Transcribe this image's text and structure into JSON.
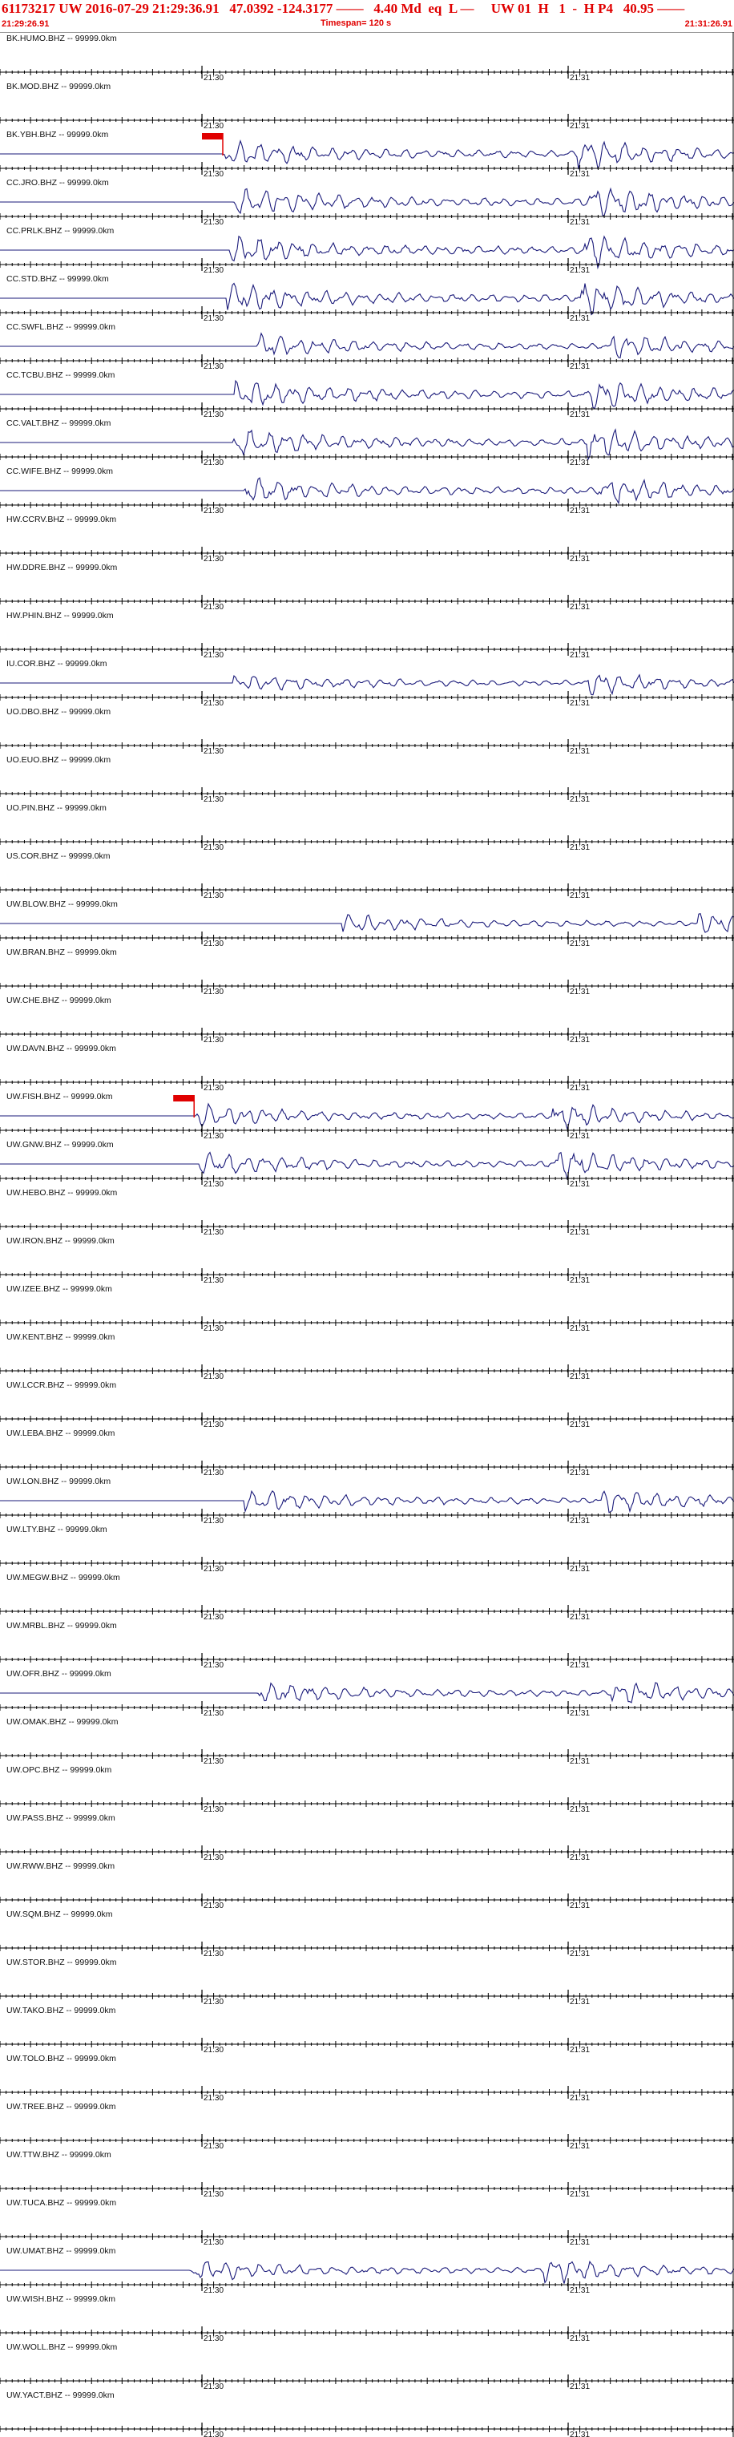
{
  "header": {
    "main": "61173217 UW 2016-07-29 21:29:36.91   47.0392 -124.3177 ——   4.40 Md  eq  L —     UW 01  H   1  -  H P4   40.95 ——",
    "left_time": "21:29:26.91",
    "right_time": "21:31:26.91",
    "timespan": "Timespan= 120 s"
  },
  "colors": {
    "header_text": "#e00000",
    "trace": "#1a1a7a",
    "pick": "#e00000",
    "axis": "#000000"
  },
  "chart_data": {
    "type": "line",
    "title": "61173217 UW 2016-07-29 21:29:36.91",
    "x_range_seconds": [
      0,
      120
    ],
    "x_tick_labels": [
      "21:30",
      "21:31"
    ],
    "x_tick_label_seconds": [
      33.09,
      93.09
    ],
    "traces": [
      {
        "label": "BK.HUMO.BHZ -- 99999.0km",
        "signal": false,
        "pick": null
      },
      {
        "label": "BK.MOD.BHZ -- 99999.0km",
        "signal": false,
        "pick": null
      },
      {
        "label": "BK.YBH.BHZ -- 99999.0km",
        "signal": true,
        "onset": 36.5,
        "amp": 0.9,
        "pick": 36.5
      },
      {
        "label": "CC.JRO.BHZ -- 99999.0km",
        "signal": true,
        "onset": 38.0,
        "amp": 1.0,
        "pick": null
      },
      {
        "label": "CC.PRLK.BHZ -- 99999.0km",
        "signal": true,
        "onset": 37.5,
        "amp": 1.0,
        "pick": null
      },
      {
        "label": "CC.STD.BHZ -- 99999.0km",
        "signal": true,
        "onset": 37.0,
        "amp": 1.0,
        "pick": null
      },
      {
        "label": "CC.SWFL.BHZ -- 99999.0km",
        "signal": true,
        "onset": 42.0,
        "amp": 0.8,
        "pick": null
      },
      {
        "label": "CC.TCBU.BHZ -- 99999.0km",
        "signal": true,
        "onset": 38.5,
        "amp": 1.0,
        "pick": null
      },
      {
        "label": "CC.VALT.BHZ -- 99999.0km",
        "signal": true,
        "onset": 38.0,
        "amp": 1.0,
        "pick": null
      },
      {
        "label": "CC.WIFE.BHZ -- 99999.0km",
        "signal": true,
        "onset": 40.0,
        "amp": 0.9,
        "pick": null
      },
      {
        "label": "HW.CCRV.BHZ -- 99999.0km",
        "signal": false,
        "pick": null
      },
      {
        "label": "HW.DDRE.BHZ -- 99999.0km",
        "signal": false,
        "pick": null
      },
      {
        "label": "HW.PHIN.BHZ -- 99999.0km",
        "signal": false,
        "pick": null
      },
      {
        "label": "IU.COR.BHZ -- 99999.0km",
        "signal": true,
        "onset": 38.0,
        "amp": 0.7,
        "pick": null
      },
      {
        "label": "UO.DBO.BHZ -- 99999.0km",
        "signal": false,
        "pick": null
      },
      {
        "label": "UO.EUO.BHZ -- 99999.0km",
        "signal": false,
        "pick": null
      },
      {
        "label": "UO.PIN.BHZ -- 99999.0km",
        "signal": false,
        "pick": null
      },
      {
        "label": "US.COR.BHZ -- 99999.0km",
        "signal": false,
        "pick": null
      },
      {
        "label": "UW.BLOW.BHZ -- 99999.0km",
        "signal": true,
        "onset": 56.0,
        "amp": 0.7,
        "pick": null
      },
      {
        "label": "UW.BRAN.BHZ -- 99999.0km",
        "signal": false,
        "pick": null
      },
      {
        "label": "UW.CHE.BHZ -- 99999.0km",
        "signal": false,
        "pick": null
      },
      {
        "label": "UW.DAVN.BHZ -- 99999.0km",
        "signal": false,
        "pick": null
      },
      {
        "label": "UW.FISH.BHZ -- 99999.0km",
        "signal": true,
        "onset": 32.0,
        "amp": 0.8,
        "pick": 31.8
      },
      {
        "label": "UW.GNW.BHZ -- 99999.0km",
        "signal": true,
        "onset": 32.5,
        "amp": 0.9,
        "pick": null
      },
      {
        "label": "UW.HEBO.BHZ -- 99999.0km",
        "signal": false,
        "pick": null
      },
      {
        "label": "UW.IRON.BHZ -- 99999.0km",
        "signal": false,
        "pick": null
      },
      {
        "label": "UW.IZEE.BHZ -- 99999.0km",
        "signal": false,
        "pick": null
      },
      {
        "label": "UW.KENT.BHZ -- 99999.0km",
        "signal": false,
        "pick": null
      },
      {
        "label": "UW.LCCR.BHZ -- 99999.0km",
        "signal": false,
        "pick": null
      },
      {
        "label": "UW.LEBA.BHZ -- 99999.0km",
        "signal": false,
        "pick": null
      },
      {
        "label": "UW.LON.BHZ -- 99999.0km",
        "signal": true,
        "onset": 40.0,
        "amp": 0.8,
        "pick": null
      },
      {
        "label": "UW.LTY.BHZ -- 99999.0km",
        "signal": false,
        "pick": null
      },
      {
        "label": "UW.MEGW.BHZ -- 99999.0km",
        "signal": false,
        "pick": null
      },
      {
        "label": "UW.MRBL.BHZ -- 99999.0km",
        "signal": false,
        "pick": null
      },
      {
        "label": "UW.OFR.BHZ -- 99999.0km",
        "signal": true,
        "onset": 42.0,
        "amp": 0.8,
        "pick": null
      },
      {
        "label": "UW.OMAK.BHZ -- 99999.0km",
        "signal": false,
        "pick": null
      },
      {
        "label": "UW.OPC.BHZ -- 99999.0km",
        "signal": false,
        "pick": null
      },
      {
        "label": "UW.PASS.BHZ -- 99999.0km",
        "signal": false,
        "pick": null
      },
      {
        "label": "UW.RWW.BHZ -- 99999.0km",
        "signal": false,
        "pick": null
      },
      {
        "label": "UW.SQM.BHZ -- 99999.0km",
        "signal": false,
        "pick": null
      },
      {
        "label": "UW.STOR.BHZ -- 99999.0km",
        "signal": false,
        "pick": null
      },
      {
        "label": "UW.TAKO.BHZ -- 99999.0km",
        "signal": false,
        "pick": null
      },
      {
        "label": "UW.TOLO.BHZ -- 99999.0km",
        "signal": false,
        "pick": null
      },
      {
        "label": "UW.TREE.BHZ -- 99999.0km",
        "signal": false,
        "pick": null
      },
      {
        "label": "UW.TTW.BHZ -- 99999.0km",
        "signal": false,
        "pick": null
      },
      {
        "label": "UW.TUCA.BHZ -- 99999.0km",
        "signal": false,
        "pick": null
      },
      {
        "label": "UW.UMAT.BHZ -- 99999.0km",
        "signal": true,
        "onset": 31.0,
        "amp": 0.8,
        "pick": null
      },
      {
        "label": "UW.WISH.BHZ -- 99999.0km",
        "signal": false,
        "pick": null
      },
      {
        "label": "UW.WOLL.BHZ -- 99999.0km",
        "signal": false,
        "pick": null
      },
      {
        "label": "UW.YACT.BHZ -- 99999.0km",
        "signal": false,
        "pick": null
      }
    ]
  }
}
